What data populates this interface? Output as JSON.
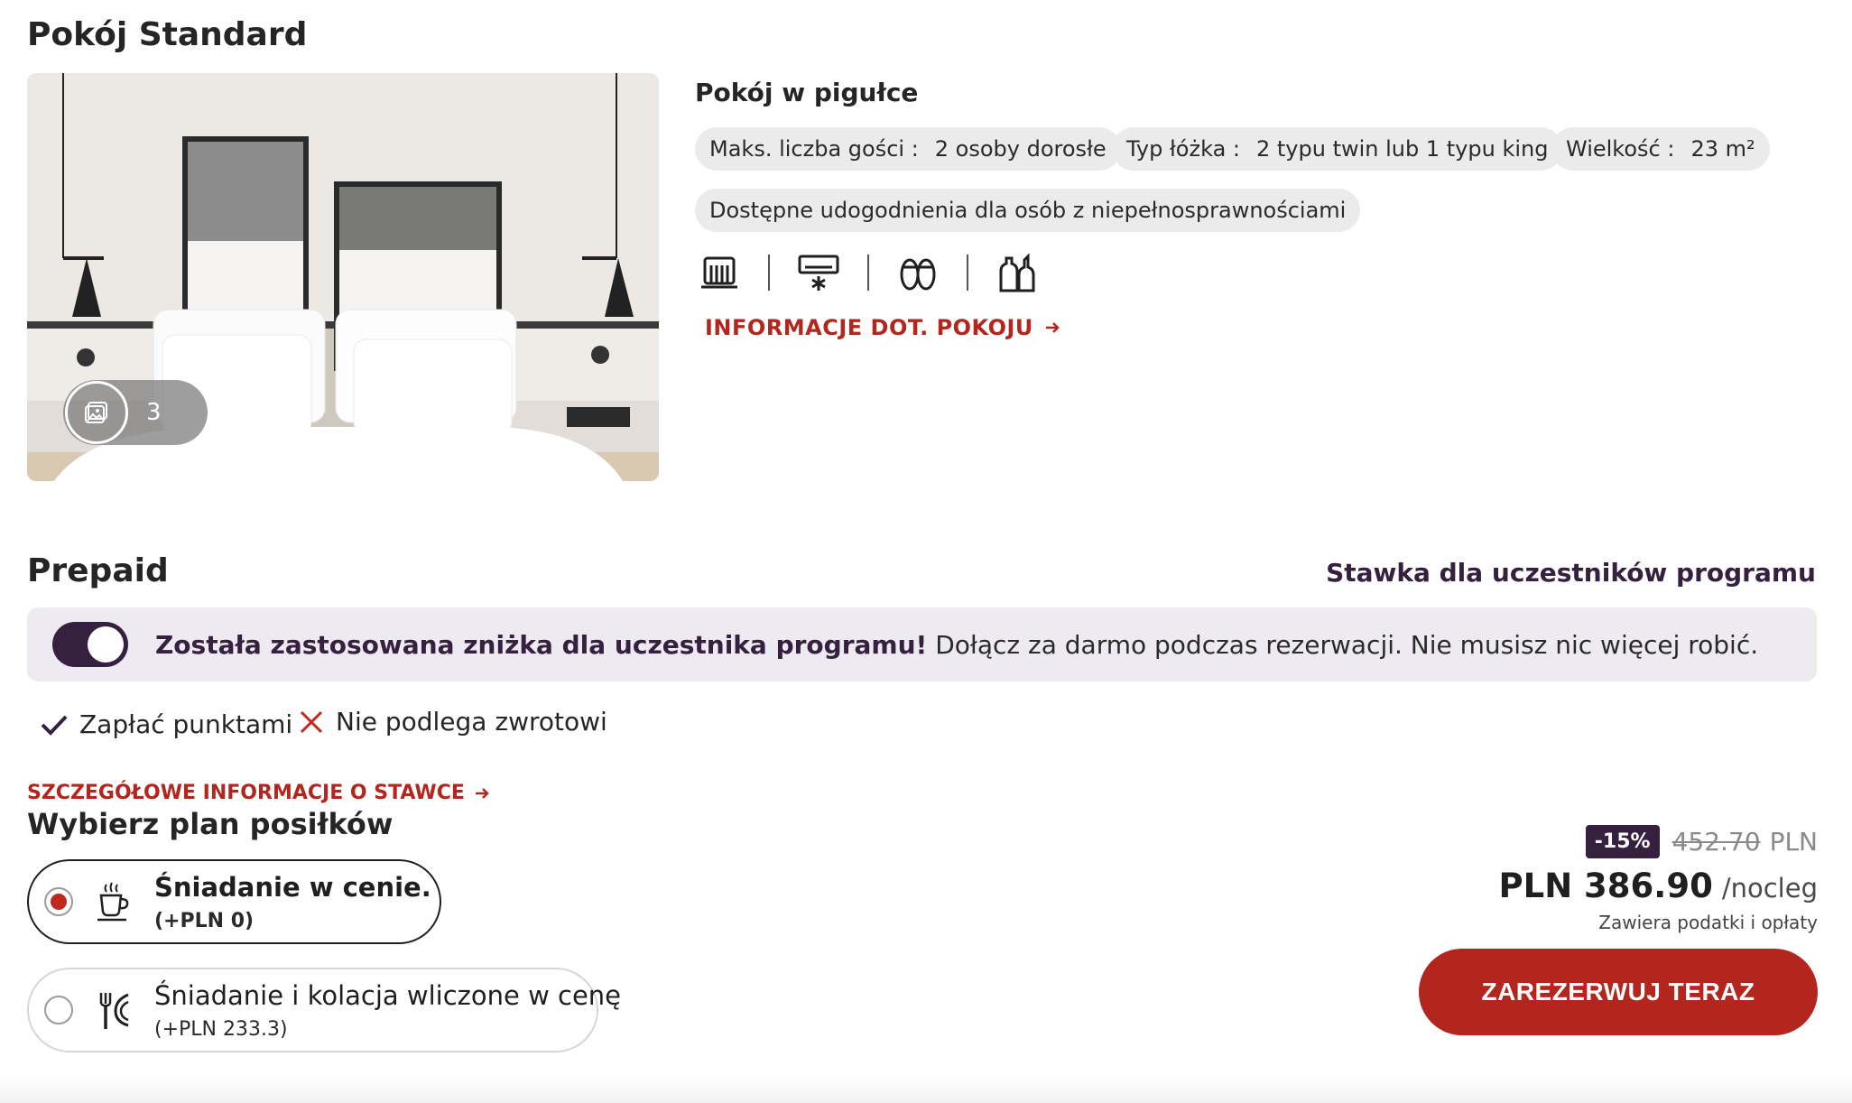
{
  "room": {
    "title": "Pokój Standard",
    "photo_count": "3",
    "summary_title": "Pokój w pigułce",
    "chips": [
      {
        "label": "Maks. liczba gości :",
        "value": "2 osoby dorosłe"
      },
      {
        "label": "Typ łóżka :",
        "value": "2 typu twin lub 1 typu king"
      },
      {
        "label": "Wielkość :",
        "value": "23 m²"
      },
      {
        "label": "Dostępne udogodnienia dla osób z niepełnosprawnościami",
        "value": ""
      }
    ],
    "amenities": [
      "radiator-icon",
      "air-conditioning-icon",
      "slippers-icon",
      "toiletries-icon"
    ],
    "info_link": "INFORMACJE DOT. POKOJU"
  },
  "rate": {
    "title": "Prepaid",
    "member_rate": "Stawka dla uczestników programu",
    "banner_bold": "Została zastosowana zniżka dla uczestnika programu!",
    "banner_text": "Dołącz za darmo podczas rezerwacji. Nie musisz nic więcej robić.",
    "features": [
      {
        "icon": "check-icon",
        "text": "Zapłać punktami"
      },
      {
        "icon": "cross-icon",
        "text": "Nie podlega zwrotowi"
      }
    ],
    "details_link": "SZCZEGÓŁOWE INFORMACJE O STAWCE"
  },
  "meals": {
    "title": "Wybierz plan posiłków",
    "options": [
      {
        "name": "Śniadanie w cenie.",
        "price": "(+PLN 0)",
        "icon": "coffee-cup-icon",
        "selected": true
      },
      {
        "name": "Śniadanie i kolacja wliczone w cenę",
        "price": "(+PLN 233.3)",
        "icon": "cutlery-icon",
        "selected": false
      }
    ]
  },
  "pricing": {
    "discount": "-15%",
    "old_price": "452.70",
    "old_currency": "PLN",
    "new_price": "PLN 386.90",
    "per_night": "/nocleg",
    "taxes_note": "Zawiera podatki i opłaty",
    "book_button": "ZAREZERWUJ TERAZ"
  },
  "colors": {
    "accent_red": "#b3261e",
    "brand_purple": "#35203f",
    "banner_bg": "#eeeaf1",
    "chip_bg": "#ebebeb"
  }
}
